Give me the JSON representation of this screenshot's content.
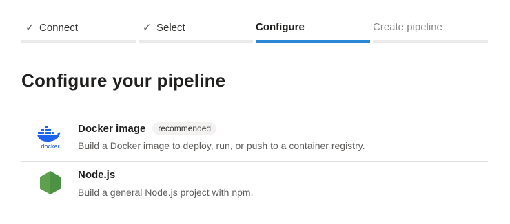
{
  "wizard": {
    "steps": [
      {
        "label": "Connect",
        "state": "done"
      },
      {
        "label": "Select",
        "state": "done"
      },
      {
        "label": "Configure",
        "state": "active"
      },
      {
        "label": "Create pipeline",
        "state": "pending"
      }
    ],
    "check_glyph": "✓"
  },
  "page": {
    "title": "Configure your pipeline"
  },
  "options": [
    {
      "name": "Docker image",
      "badge": "recommended",
      "description": "Build a Docker image to deploy, run, or push to a container registry.",
      "icon": "docker-icon",
      "icon_text": "docker"
    },
    {
      "name": "Node.js",
      "description": "Build a general Node.js project with npm.",
      "icon": "nodejs-icon"
    }
  ],
  "colors": {
    "accent": "#2b88d8",
    "docker_blue": "#1d63ed",
    "node_green": "#5fa04e"
  }
}
